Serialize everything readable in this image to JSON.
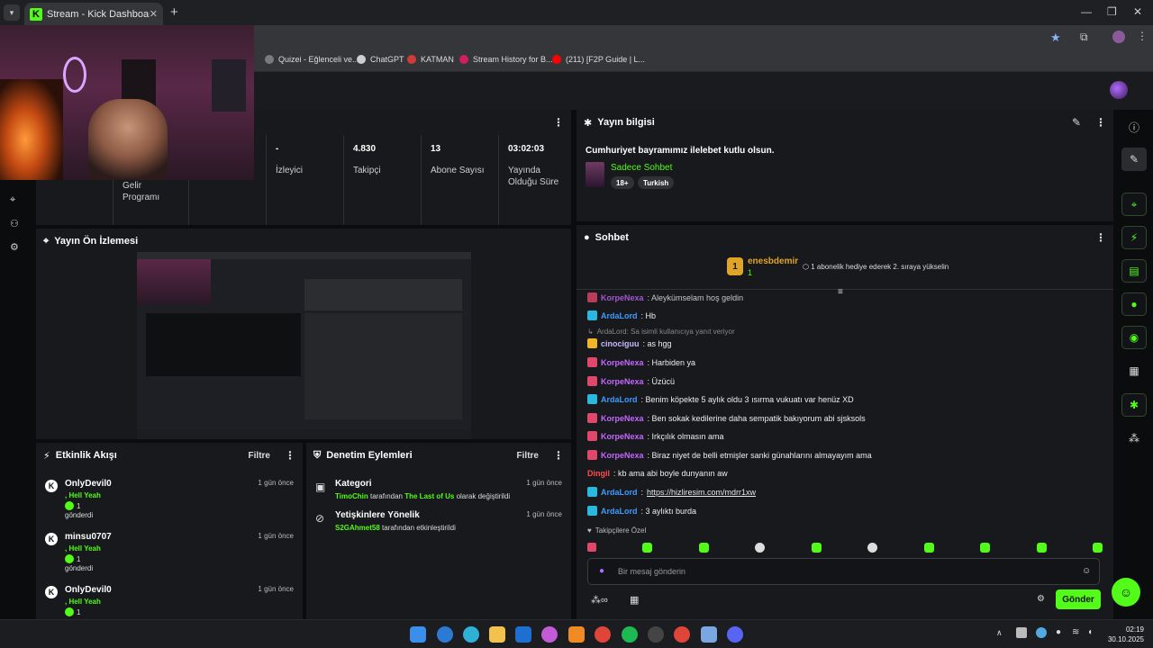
{
  "browser": {
    "tab_title": "Stream - Kick Dashboard",
    "tab_favicon": "K",
    "tab_close": "✕",
    "new_tab": "+",
    "bookmarks": [
      {
        "label": "Quizei - Eğlenceli ve...",
        "color": "#7a7a7a"
      },
      {
        "label": "ChatGPT",
        "color": "#cfcfcf"
      },
      {
        "label": "KATMAN",
        "color": "#d23a3a"
      },
      {
        "label": "Stream History for B...",
        "color": "#d21e5e"
      },
      {
        "label": "(211) [F2P Guide | L...",
        "color": "#ff0000"
      }
    ]
  },
  "stats": {
    "col0_label": "Gelir Programı",
    "viewers_value": "-",
    "viewers_label": "İzleyici",
    "followers_value": "4.830",
    "followers_label": "Takipçi",
    "subs_value": "13",
    "subs_label": "Abone Sayısı",
    "uptime_value": "03:02:03",
    "uptime_label": "Yayında Olduğu Süre"
  },
  "stream_info": {
    "header": "Yayın bilgisi",
    "title": "Cumhuriyet bayramımız ilelebet kutlu olsun.",
    "category": "Sadece Sohbet",
    "tags": [
      "18+",
      "Turkish"
    ]
  },
  "preview": {
    "header": "Yayın Ön İzlemesi"
  },
  "activity": {
    "header": "Etkinlik Akışı",
    "filter": "Filtre",
    "events": [
      {
        "name": "OnlyDevil0",
        "time": "1 gün önce",
        "line2": ", Hell Yeah",
        "count": "1",
        "line4": "gönderdi"
      },
      {
        "name": "minsu0707",
        "time": "1 gün önce",
        "line2": ", Hell Yeah",
        "count": "1",
        "line4": "gönderdi"
      },
      {
        "name": "OnlyDevil0",
        "time": "1 gün önce",
        "line2": ", Hell Yeah",
        "count": "1",
        "line4": ""
      }
    ]
  },
  "moderation": {
    "header": "Denetim Eylemleri",
    "filter": "Filtre",
    "items": [
      {
        "title": "Kategori",
        "time": "1 gün önce",
        "actor": "TimoChin",
        "mid": " tarafından ",
        "target": "The Last of Us",
        "end": " olarak değiştirildi"
      },
      {
        "title": "Yetişkinlere Yönelik",
        "time": "1 gün önce",
        "actor": "S2GAhmet58",
        "mid": " tarafından etkinleştirildi",
        "target": "",
        "end": ""
      }
    ]
  },
  "chat": {
    "header": "Sohbet",
    "pinned_user": "enesbdemir",
    "pinned_count": "1",
    "pinned_rank": "1",
    "pinned_text": "1 abonelik hediye ederek 2. sıraya yükselin",
    "reply_note": "ArdaLord: Sa isimli kullanıcıya yanıt veriyor",
    "messages": [
      {
        "user": "KorpeNexa",
        "color": "#c566ff",
        "badge": "#e0476b",
        "text": ": Aleykümselam hoş geldin"
      },
      {
        "user": "ArdaLord",
        "color": "#3d9cff",
        "badge": "#2bb8e0",
        "text": ": Hb"
      },
      {
        "user": "cinociguu",
        "color": "#c9b6ff",
        "badge": "#f0b429",
        "text": ": as hgg"
      },
      {
        "user": "KorpeNexa",
        "color": "#c566ff",
        "badge": "#e0476b",
        "text": ": Harbiden ya"
      },
      {
        "user": "KorpeNexa",
        "color": "#c566ff",
        "badge": "#e0476b",
        "text": ": Üzücü"
      },
      {
        "user": "ArdaLord",
        "color": "#3d9cff",
        "badge": "#2bb8e0",
        "text": ": Benim köpekte 5 aylık oldu 3 ısırma vukuatı var henüz XD"
      },
      {
        "user": "KorpeNexa",
        "color": "#c566ff",
        "badge": "#e0476b",
        "text": ": Ben sokak kedilerine daha sempatik bakıyorum abi sjsksols"
      },
      {
        "user": "KorpeNexa",
        "color": "#c566ff",
        "badge": "#e0476b",
        "text": ": Irkçılık olmasın ama"
      },
      {
        "user": "KorpeNexa",
        "color": "#c566ff",
        "badge": "#e0476b",
        "text": ": Biraz niyet de belli etmişler sanki günahlarını almayayım ama"
      },
      {
        "user": "Dingil",
        "color": "#ff4d4d",
        "badge": "",
        "text": ": kb ama abi boyle dunyanın aw"
      },
      {
        "user": "ArdaLord",
        "color": "#3d9cff",
        "badge": "#2bb8e0",
        "text": ": ",
        "link": "https://hizliresim.com/mdrr1xw"
      },
      {
        "user": "ArdaLord",
        "color": "#3d9cff",
        "badge": "#2bb8e0",
        "text": ": 3 aylıktı burda"
      }
    ],
    "followers_only": "Takipçilere Özel",
    "input_placeholder": "Bir mesaj gönderin",
    "send": "Gönder"
  },
  "clock": {
    "time": "02:19",
    "date": "30.10.2025"
  },
  "colors": {
    "kick_green": "#53fc18",
    "panel": "#17191c",
    "bg": "#0b0c0e"
  }
}
